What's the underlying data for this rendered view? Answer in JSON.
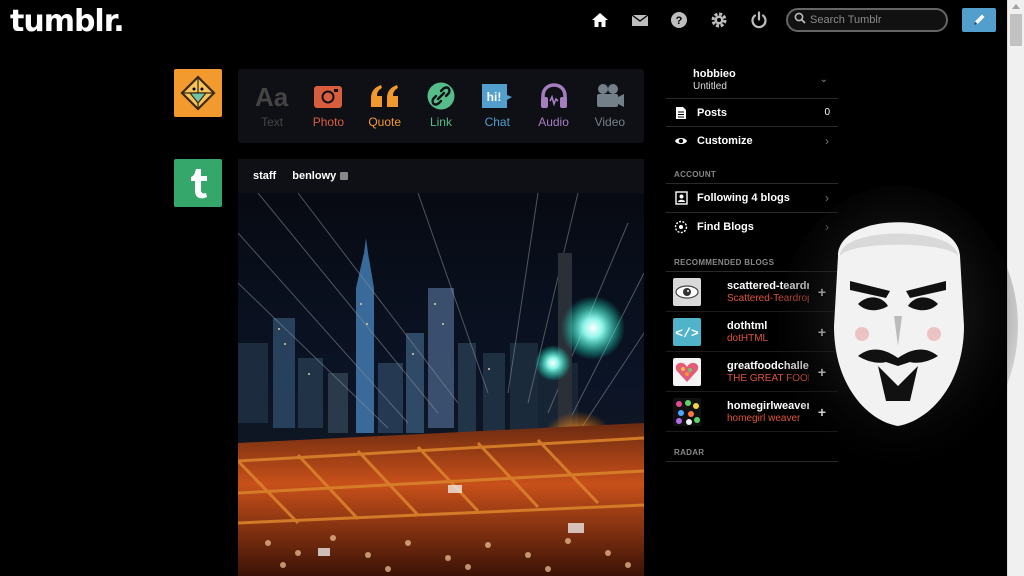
{
  "header": {
    "logo": "tumblr.",
    "search_placeholder": "Search Tumblr",
    "nav_icons": [
      "home-icon",
      "inbox-icon",
      "help-icon",
      "settings-icon",
      "power-icon"
    ],
    "compose_icon": "pencil-icon"
  },
  "post_types": [
    {
      "label": "Text",
      "color": "#444444"
    },
    {
      "label": "Photo",
      "color": "#d95e40"
    },
    {
      "label": "Quote",
      "color": "#f2992e"
    },
    {
      "label": "Link",
      "color": "#56bc8a"
    },
    {
      "label": "Chat",
      "color": "#529ecc"
    },
    {
      "label": "Audio",
      "color": "#a77dc2"
    },
    {
      "label": "Video",
      "color": "#748089"
    }
  ],
  "post": {
    "author": "staff",
    "reblogged_from": "benlowy"
  },
  "sidebar": {
    "blog": {
      "name": "hobbieo",
      "title": "Untitled"
    },
    "items": [
      {
        "label": "Posts",
        "count": "0"
      },
      {
        "label": "Customize"
      }
    ],
    "account_heading": "ACCOUNT",
    "account_items": [
      {
        "label": "Following 4 blogs"
      },
      {
        "label": "Find Blogs"
      }
    ],
    "recommended_heading": "RECOMMENDED BLOGS",
    "recommended": [
      {
        "name": "scattered-teardrops",
        "title": "Scattered-Teardrops"
      },
      {
        "name": "dothtml",
        "title": "dotHTML"
      },
      {
        "name": "greatfoodchallenge",
        "title": "THE GREAT FOOD CHALLENGE"
      },
      {
        "name": "homegirlweaver",
        "title": "homegirl weaver"
      }
    ],
    "radar_heading": "RADAR"
  },
  "colors": {
    "brand_blue": "#529ecc",
    "accent_red": "#e0553a",
    "avatar_orange": "#f29a2e",
    "avatar_green": "#36a76b"
  }
}
